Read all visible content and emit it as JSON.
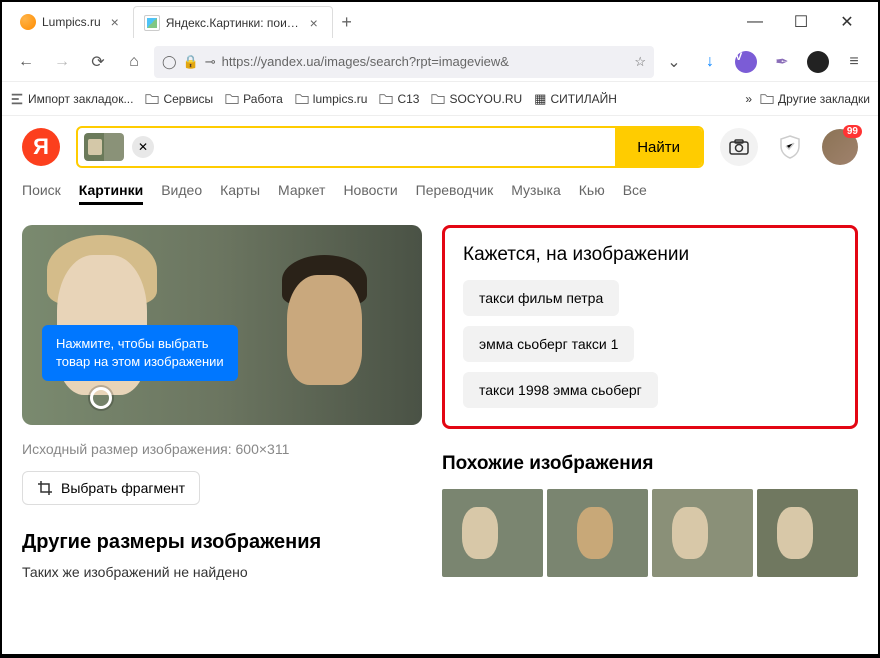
{
  "tabs": [
    {
      "title": "Lumpics.ru"
    },
    {
      "title": "Яндекс.Картинки: поиск по из"
    }
  ],
  "url": {
    "text": "https://yandex.ua/images/search?rpt=imageview&"
  },
  "bookmarks": {
    "import": "Импорт закладок...",
    "items": [
      "Сервисы",
      "Работа",
      "lumpics.ru",
      "C13",
      "SOCYOU.RU",
      "СИТИЛАЙН"
    ],
    "other": "Другие закладки"
  },
  "search": {
    "button": "Найти",
    "badge": "99"
  },
  "nav": [
    "Поиск",
    "Картинки",
    "Видео",
    "Карты",
    "Маркет",
    "Новости",
    "Переводчик",
    "Музыка",
    "Кью",
    "Все"
  ],
  "preview": {
    "tooltip_line1": "Нажмите, чтобы выбрать",
    "tooltip_line2": "товар на этом изображении",
    "meta": "Исходный размер изображения: 600×311",
    "crop": "Выбрать фрагмент"
  },
  "other_sizes": {
    "title": "Другие размеры изображения",
    "empty": "Таких же изображений не найдено"
  },
  "suggest": {
    "title": "Кажется, на изображении",
    "chips": [
      "такси фильм петра",
      "эмма сьоберг такси 1",
      "такси 1998 эмма сьоберг"
    ]
  },
  "similar": {
    "title": "Похожие изображения"
  }
}
